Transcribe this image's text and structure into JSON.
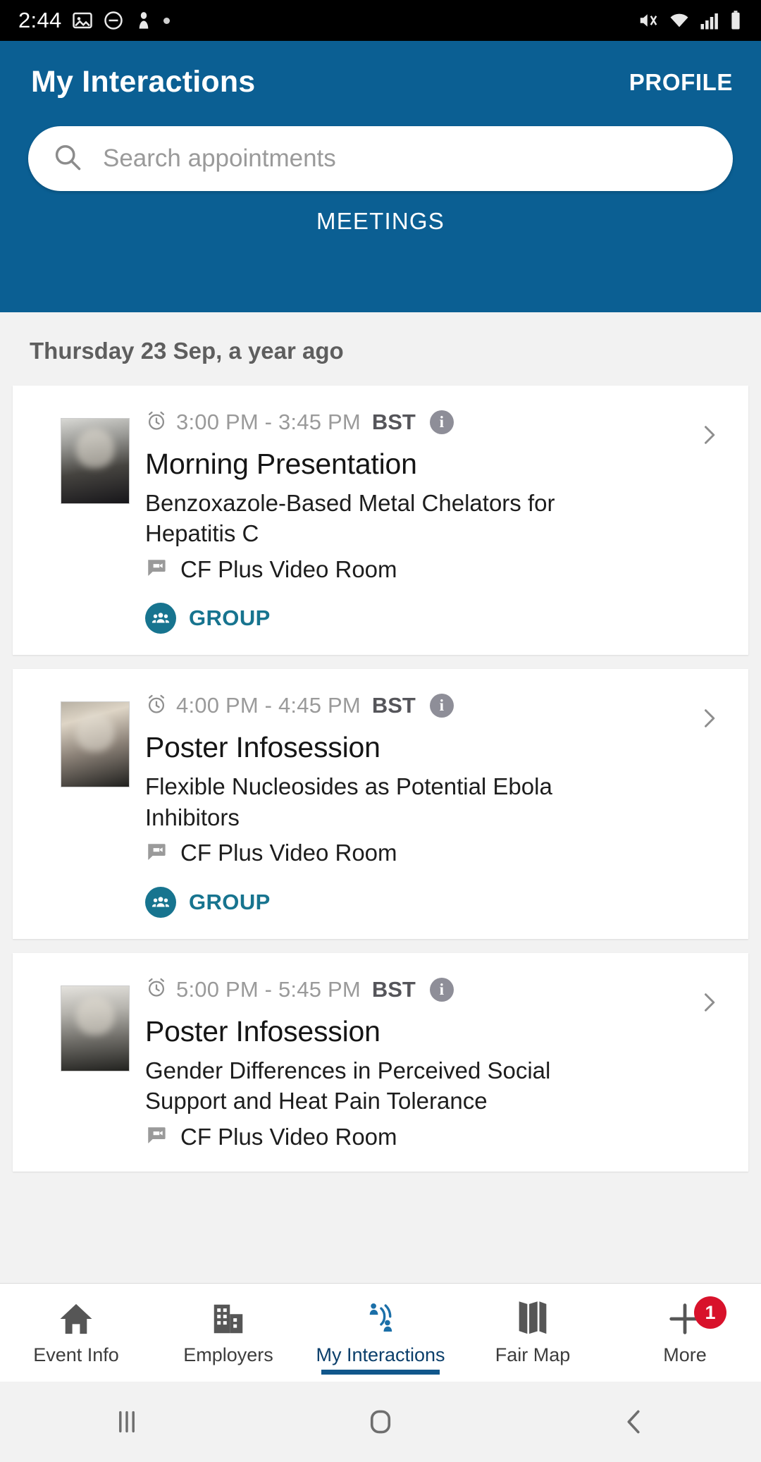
{
  "status_bar": {
    "clock": "2:44",
    "left_icons": [
      "image-icon",
      "do-not-disturb-icon",
      "person-icon",
      "dot-icon"
    ],
    "right_icons": [
      "mute-icon",
      "wifi-icon",
      "signal-icon",
      "battery-icon"
    ]
  },
  "header": {
    "title": "My Interactions",
    "profile_label": "PROFILE",
    "search": {
      "placeholder": "Search appointments",
      "value": ""
    },
    "tabs": [
      {
        "label": "MEETINGS",
        "active": true
      }
    ],
    "accent_color": "#0b5f93"
  },
  "content": {
    "date_header": "Thursday 23 Sep, a year ago",
    "cards": [
      {
        "time": "3:00 PM - 3:45 PM",
        "timezone": "BST",
        "title": "Morning Presentation",
        "subtitle": "Benzoxazole-Based Metal Chelators for Hepatitis C",
        "room": "CF Plus Video Room",
        "badge_label": "GROUP",
        "badge_color": "#17748f"
      },
      {
        "time": "4:00 PM - 4:45 PM",
        "timezone": "BST",
        "title": "Poster Infosession",
        "subtitle": "Flexible Nucleosides as Potential Ebola Inhibitors",
        "room": "CF Plus Video Room",
        "badge_label": "GROUP",
        "badge_color": "#17748f"
      },
      {
        "time": "5:00 PM - 5:45 PM",
        "timezone": "BST",
        "title": "Poster Infosession",
        "subtitle": "Gender Differences in Perceived Social Support and Heat Pain Tolerance",
        "room": "CF Plus Video Room",
        "badge_label": "",
        "badge_color": "#17748f"
      }
    ]
  },
  "bottom_nav": {
    "items": [
      {
        "label": "Event Info",
        "icon": "home-icon",
        "active": false
      },
      {
        "label": "Employers",
        "icon": "building-icon",
        "active": false
      },
      {
        "label": "My Interactions",
        "icon": "interactions-icon",
        "active": true
      },
      {
        "label": "Fair Map",
        "icon": "map-icon",
        "active": false
      },
      {
        "label": "More",
        "icon": "plus-icon",
        "active": false,
        "badge": "1"
      }
    ],
    "active_color": "#11578c",
    "badge_color": "#d8122b"
  },
  "system_nav": {
    "recents": "recents-icon",
    "home": "home-square-icon",
    "back": "back-icon"
  }
}
